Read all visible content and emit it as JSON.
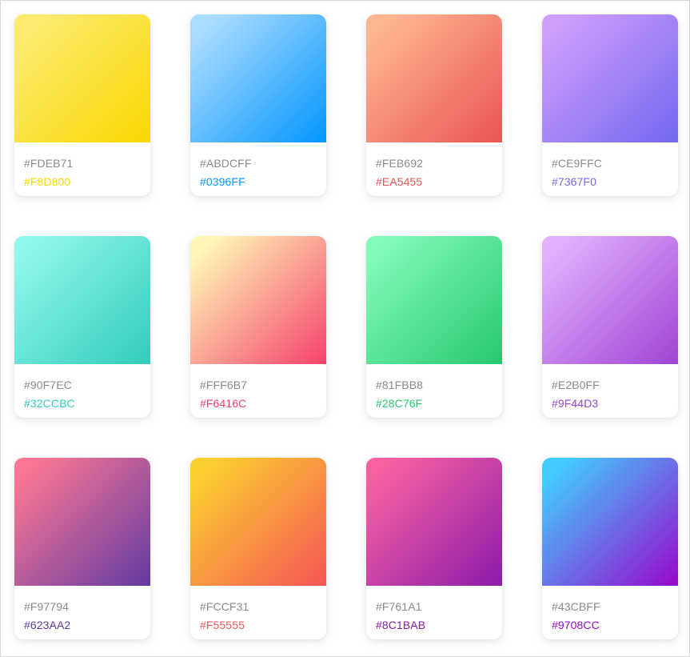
{
  "gradients": [
    {
      "from": "#FDEB71",
      "to": "#F8D800"
    },
    {
      "from": "#ABDCFF",
      "to": "#0396FF"
    },
    {
      "from": "#FEB692",
      "to": "#EA5455"
    },
    {
      "from": "#CE9FFC",
      "to": "#7367F0"
    },
    {
      "from": "#90F7EC",
      "to": "#32CCBC"
    },
    {
      "from": "#FFF6B7",
      "to": "#F6416C"
    },
    {
      "from": "#81FBB8",
      "to": "#28C76F"
    },
    {
      "from": "#E2B0FF",
      "to": "#9F44D3"
    },
    {
      "from": "#F97794",
      "to": "#623AA2"
    },
    {
      "from": "#FCCF31",
      "to": "#F55555"
    },
    {
      "from": "#F761A1",
      "to": "#8C1BAB"
    },
    {
      "from": "#43CBFF",
      "to": "#9708CC"
    }
  ]
}
